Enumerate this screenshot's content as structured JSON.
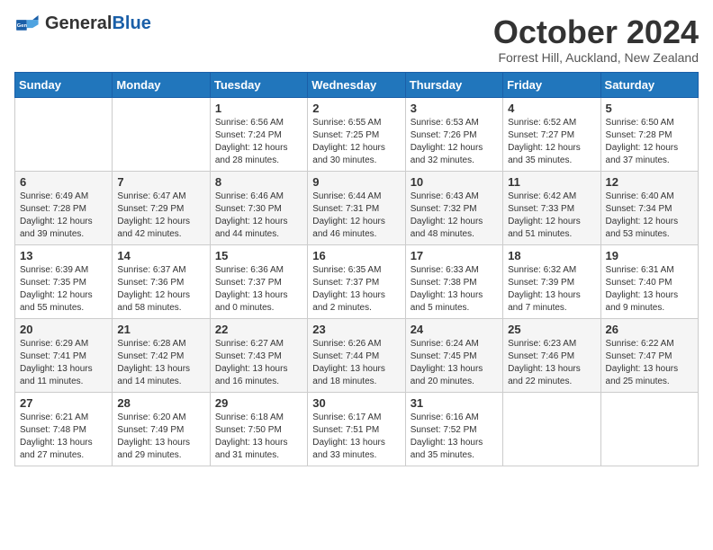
{
  "logo": {
    "general": "General",
    "blue": "Blue"
  },
  "title": "October 2024",
  "location": "Forrest Hill, Auckland, New Zealand",
  "days_header": [
    "Sunday",
    "Monday",
    "Tuesday",
    "Wednesday",
    "Thursday",
    "Friday",
    "Saturday"
  ],
  "weeks": [
    [
      {
        "day": "",
        "info": ""
      },
      {
        "day": "",
        "info": ""
      },
      {
        "day": "1",
        "info": "Sunrise: 6:56 AM\nSunset: 7:24 PM\nDaylight: 12 hours and 28 minutes."
      },
      {
        "day": "2",
        "info": "Sunrise: 6:55 AM\nSunset: 7:25 PM\nDaylight: 12 hours and 30 minutes."
      },
      {
        "day": "3",
        "info": "Sunrise: 6:53 AM\nSunset: 7:26 PM\nDaylight: 12 hours and 32 minutes."
      },
      {
        "day": "4",
        "info": "Sunrise: 6:52 AM\nSunset: 7:27 PM\nDaylight: 12 hours and 35 minutes."
      },
      {
        "day": "5",
        "info": "Sunrise: 6:50 AM\nSunset: 7:28 PM\nDaylight: 12 hours and 37 minutes."
      }
    ],
    [
      {
        "day": "6",
        "info": "Sunrise: 6:49 AM\nSunset: 7:28 PM\nDaylight: 12 hours and 39 minutes."
      },
      {
        "day": "7",
        "info": "Sunrise: 6:47 AM\nSunset: 7:29 PM\nDaylight: 12 hours and 42 minutes."
      },
      {
        "day": "8",
        "info": "Sunrise: 6:46 AM\nSunset: 7:30 PM\nDaylight: 12 hours and 44 minutes."
      },
      {
        "day": "9",
        "info": "Sunrise: 6:44 AM\nSunset: 7:31 PM\nDaylight: 12 hours and 46 minutes."
      },
      {
        "day": "10",
        "info": "Sunrise: 6:43 AM\nSunset: 7:32 PM\nDaylight: 12 hours and 48 minutes."
      },
      {
        "day": "11",
        "info": "Sunrise: 6:42 AM\nSunset: 7:33 PM\nDaylight: 12 hours and 51 minutes."
      },
      {
        "day": "12",
        "info": "Sunrise: 6:40 AM\nSunset: 7:34 PM\nDaylight: 12 hours and 53 minutes."
      }
    ],
    [
      {
        "day": "13",
        "info": "Sunrise: 6:39 AM\nSunset: 7:35 PM\nDaylight: 12 hours and 55 minutes."
      },
      {
        "day": "14",
        "info": "Sunrise: 6:37 AM\nSunset: 7:36 PM\nDaylight: 12 hours and 58 minutes."
      },
      {
        "day": "15",
        "info": "Sunrise: 6:36 AM\nSunset: 7:37 PM\nDaylight: 13 hours and 0 minutes."
      },
      {
        "day": "16",
        "info": "Sunrise: 6:35 AM\nSunset: 7:37 PM\nDaylight: 13 hours and 2 minutes."
      },
      {
        "day": "17",
        "info": "Sunrise: 6:33 AM\nSunset: 7:38 PM\nDaylight: 13 hours and 5 minutes."
      },
      {
        "day": "18",
        "info": "Sunrise: 6:32 AM\nSunset: 7:39 PM\nDaylight: 13 hours and 7 minutes."
      },
      {
        "day": "19",
        "info": "Sunrise: 6:31 AM\nSunset: 7:40 PM\nDaylight: 13 hours and 9 minutes."
      }
    ],
    [
      {
        "day": "20",
        "info": "Sunrise: 6:29 AM\nSunset: 7:41 PM\nDaylight: 13 hours and 11 minutes."
      },
      {
        "day": "21",
        "info": "Sunrise: 6:28 AM\nSunset: 7:42 PM\nDaylight: 13 hours and 14 minutes."
      },
      {
        "day": "22",
        "info": "Sunrise: 6:27 AM\nSunset: 7:43 PM\nDaylight: 13 hours and 16 minutes."
      },
      {
        "day": "23",
        "info": "Sunrise: 6:26 AM\nSunset: 7:44 PM\nDaylight: 13 hours and 18 minutes."
      },
      {
        "day": "24",
        "info": "Sunrise: 6:24 AM\nSunset: 7:45 PM\nDaylight: 13 hours and 20 minutes."
      },
      {
        "day": "25",
        "info": "Sunrise: 6:23 AM\nSunset: 7:46 PM\nDaylight: 13 hours and 22 minutes."
      },
      {
        "day": "26",
        "info": "Sunrise: 6:22 AM\nSunset: 7:47 PM\nDaylight: 13 hours and 25 minutes."
      }
    ],
    [
      {
        "day": "27",
        "info": "Sunrise: 6:21 AM\nSunset: 7:48 PM\nDaylight: 13 hours and 27 minutes."
      },
      {
        "day": "28",
        "info": "Sunrise: 6:20 AM\nSunset: 7:49 PM\nDaylight: 13 hours and 29 minutes."
      },
      {
        "day": "29",
        "info": "Sunrise: 6:18 AM\nSunset: 7:50 PM\nDaylight: 13 hours and 31 minutes."
      },
      {
        "day": "30",
        "info": "Sunrise: 6:17 AM\nSunset: 7:51 PM\nDaylight: 13 hours and 33 minutes."
      },
      {
        "day": "31",
        "info": "Sunrise: 6:16 AM\nSunset: 7:52 PM\nDaylight: 13 hours and 35 minutes."
      },
      {
        "day": "",
        "info": ""
      },
      {
        "day": "",
        "info": ""
      }
    ]
  ]
}
